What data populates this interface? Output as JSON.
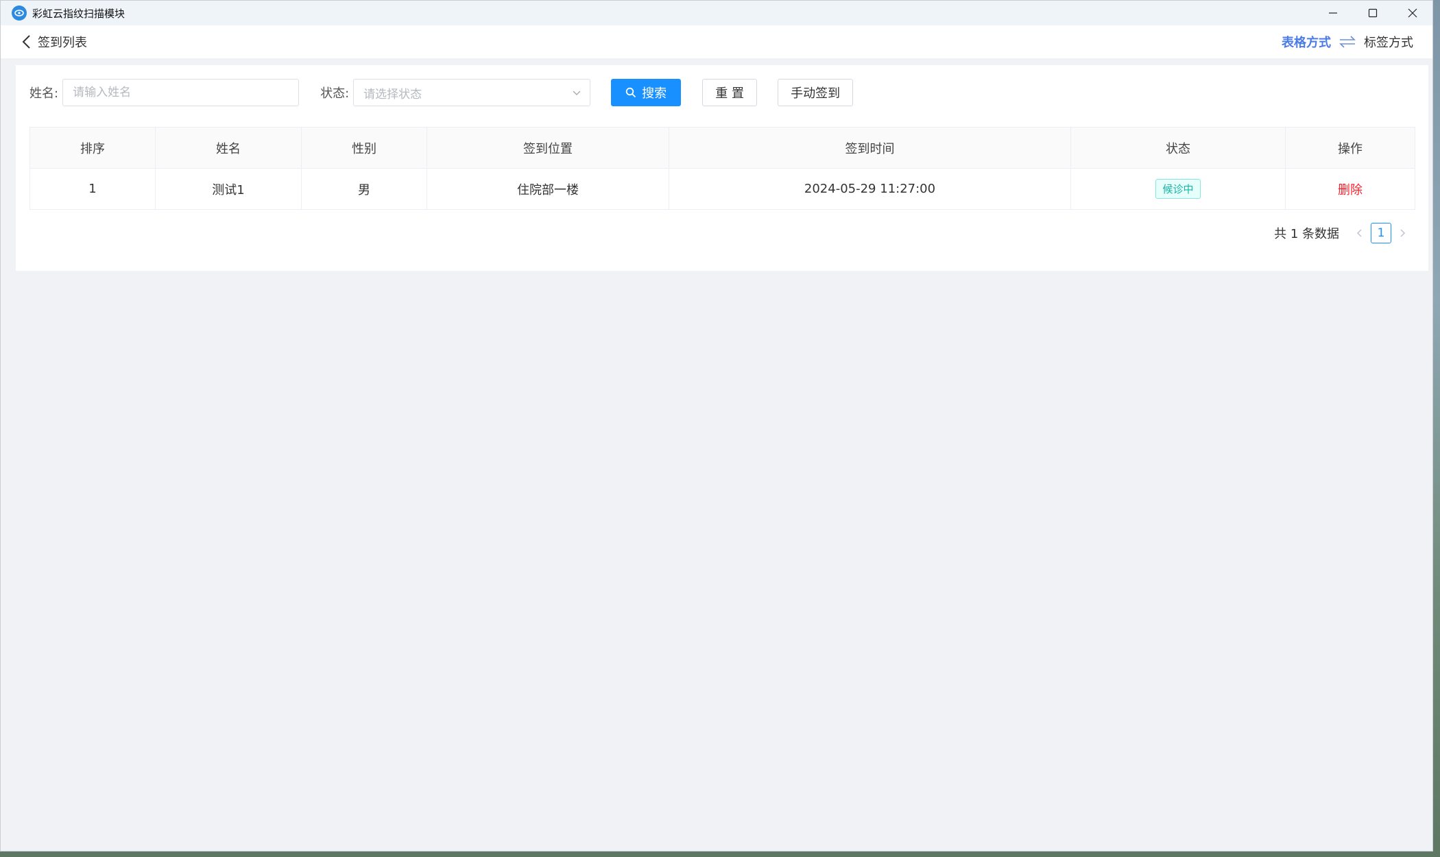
{
  "window": {
    "title": "彩虹云指纹扫描模块",
    "icon": "app-logo-icon"
  },
  "header": {
    "back_icon": "chevron-left-icon",
    "title": "签到列表",
    "view_table_label": "表格方式",
    "swap_icon": "swap-arrows-icon",
    "view_tag_label": "标签方式"
  },
  "search": {
    "name_label": "姓名:",
    "name_placeholder": "请输入姓名",
    "name_value": "",
    "status_label": "状态:",
    "status_placeholder": "请选择状态",
    "search_button": "搜索",
    "reset_button": "重 置",
    "manual_button": "手动签到"
  },
  "table": {
    "columns": [
      "排序",
      "姓名",
      "性别",
      "签到位置",
      "签到时间",
      "状态",
      "操作"
    ],
    "rows": [
      {
        "index": "1",
        "name": "测试1",
        "gender": "男",
        "location": "住院部一楼",
        "time": "2024-05-29 11:27:00",
        "status": "候诊中",
        "action": "删除"
      }
    ]
  },
  "pagination": {
    "total_text": "共 1 条数据",
    "current_page": "1"
  },
  "colors": {
    "primary": "#1890ff",
    "view_active": "#4a7be6",
    "delete": "#f5222d",
    "status_tag": "#13b5a6"
  }
}
